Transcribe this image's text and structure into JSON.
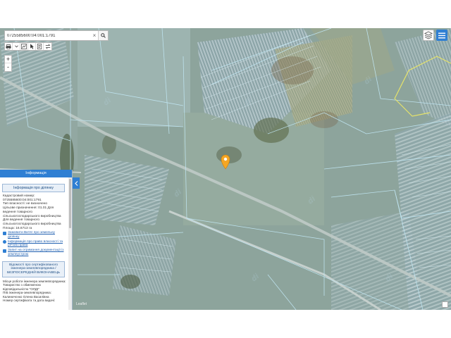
{
  "search": {
    "value": "0725585600:04:001:1791"
  },
  "toolbar": {
    "tools": [
      "print-icon",
      "measure-icon",
      "select-icon",
      "info-icon",
      "swap-icon"
    ]
  },
  "zoom": {
    "in_label": "+",
    "out_label": "-"
  },
  "panel": {
    "header": "Інформація",
    "section_title": "Інформація про ділянку",
    "info_lines": [
      "Кадастровий номер:",
      "0725585600:04:001:1791",
      "Тип власності: не визначено",
      "Цільове призначення: 01.01 Для ведення товарного сільськогосподарського виробництва",
      "Для ведення товарного сільськогосподарського виробництва",
      "Площа: 16.6713 га"
    ],
    "links": [
      "Замовити Витяг про земельну ділянку",
      "Інформація про право власності та речові права",
      "Запит на отримання документації із землеустрою"
    ],
    "cert_title": "Відомості про сертифікованого інженера-землевпорядника / БЕЗПОСЕРЕДНІЙ ВИКОНАВЕЦЬ",
    "cert_lines": [
      "Місце роботи інженера землевпорядника: Товариство з обмеженою відповідальністю \"ОЛДІ\"",
      "ПІБ інженера-землевпорядника: Калиничєнко Олена Василівна",
      "Номер сертифіката та дата видачі:"
    ]
  },
  "map": {
    "attribution": "Leaflet"
  }
}
